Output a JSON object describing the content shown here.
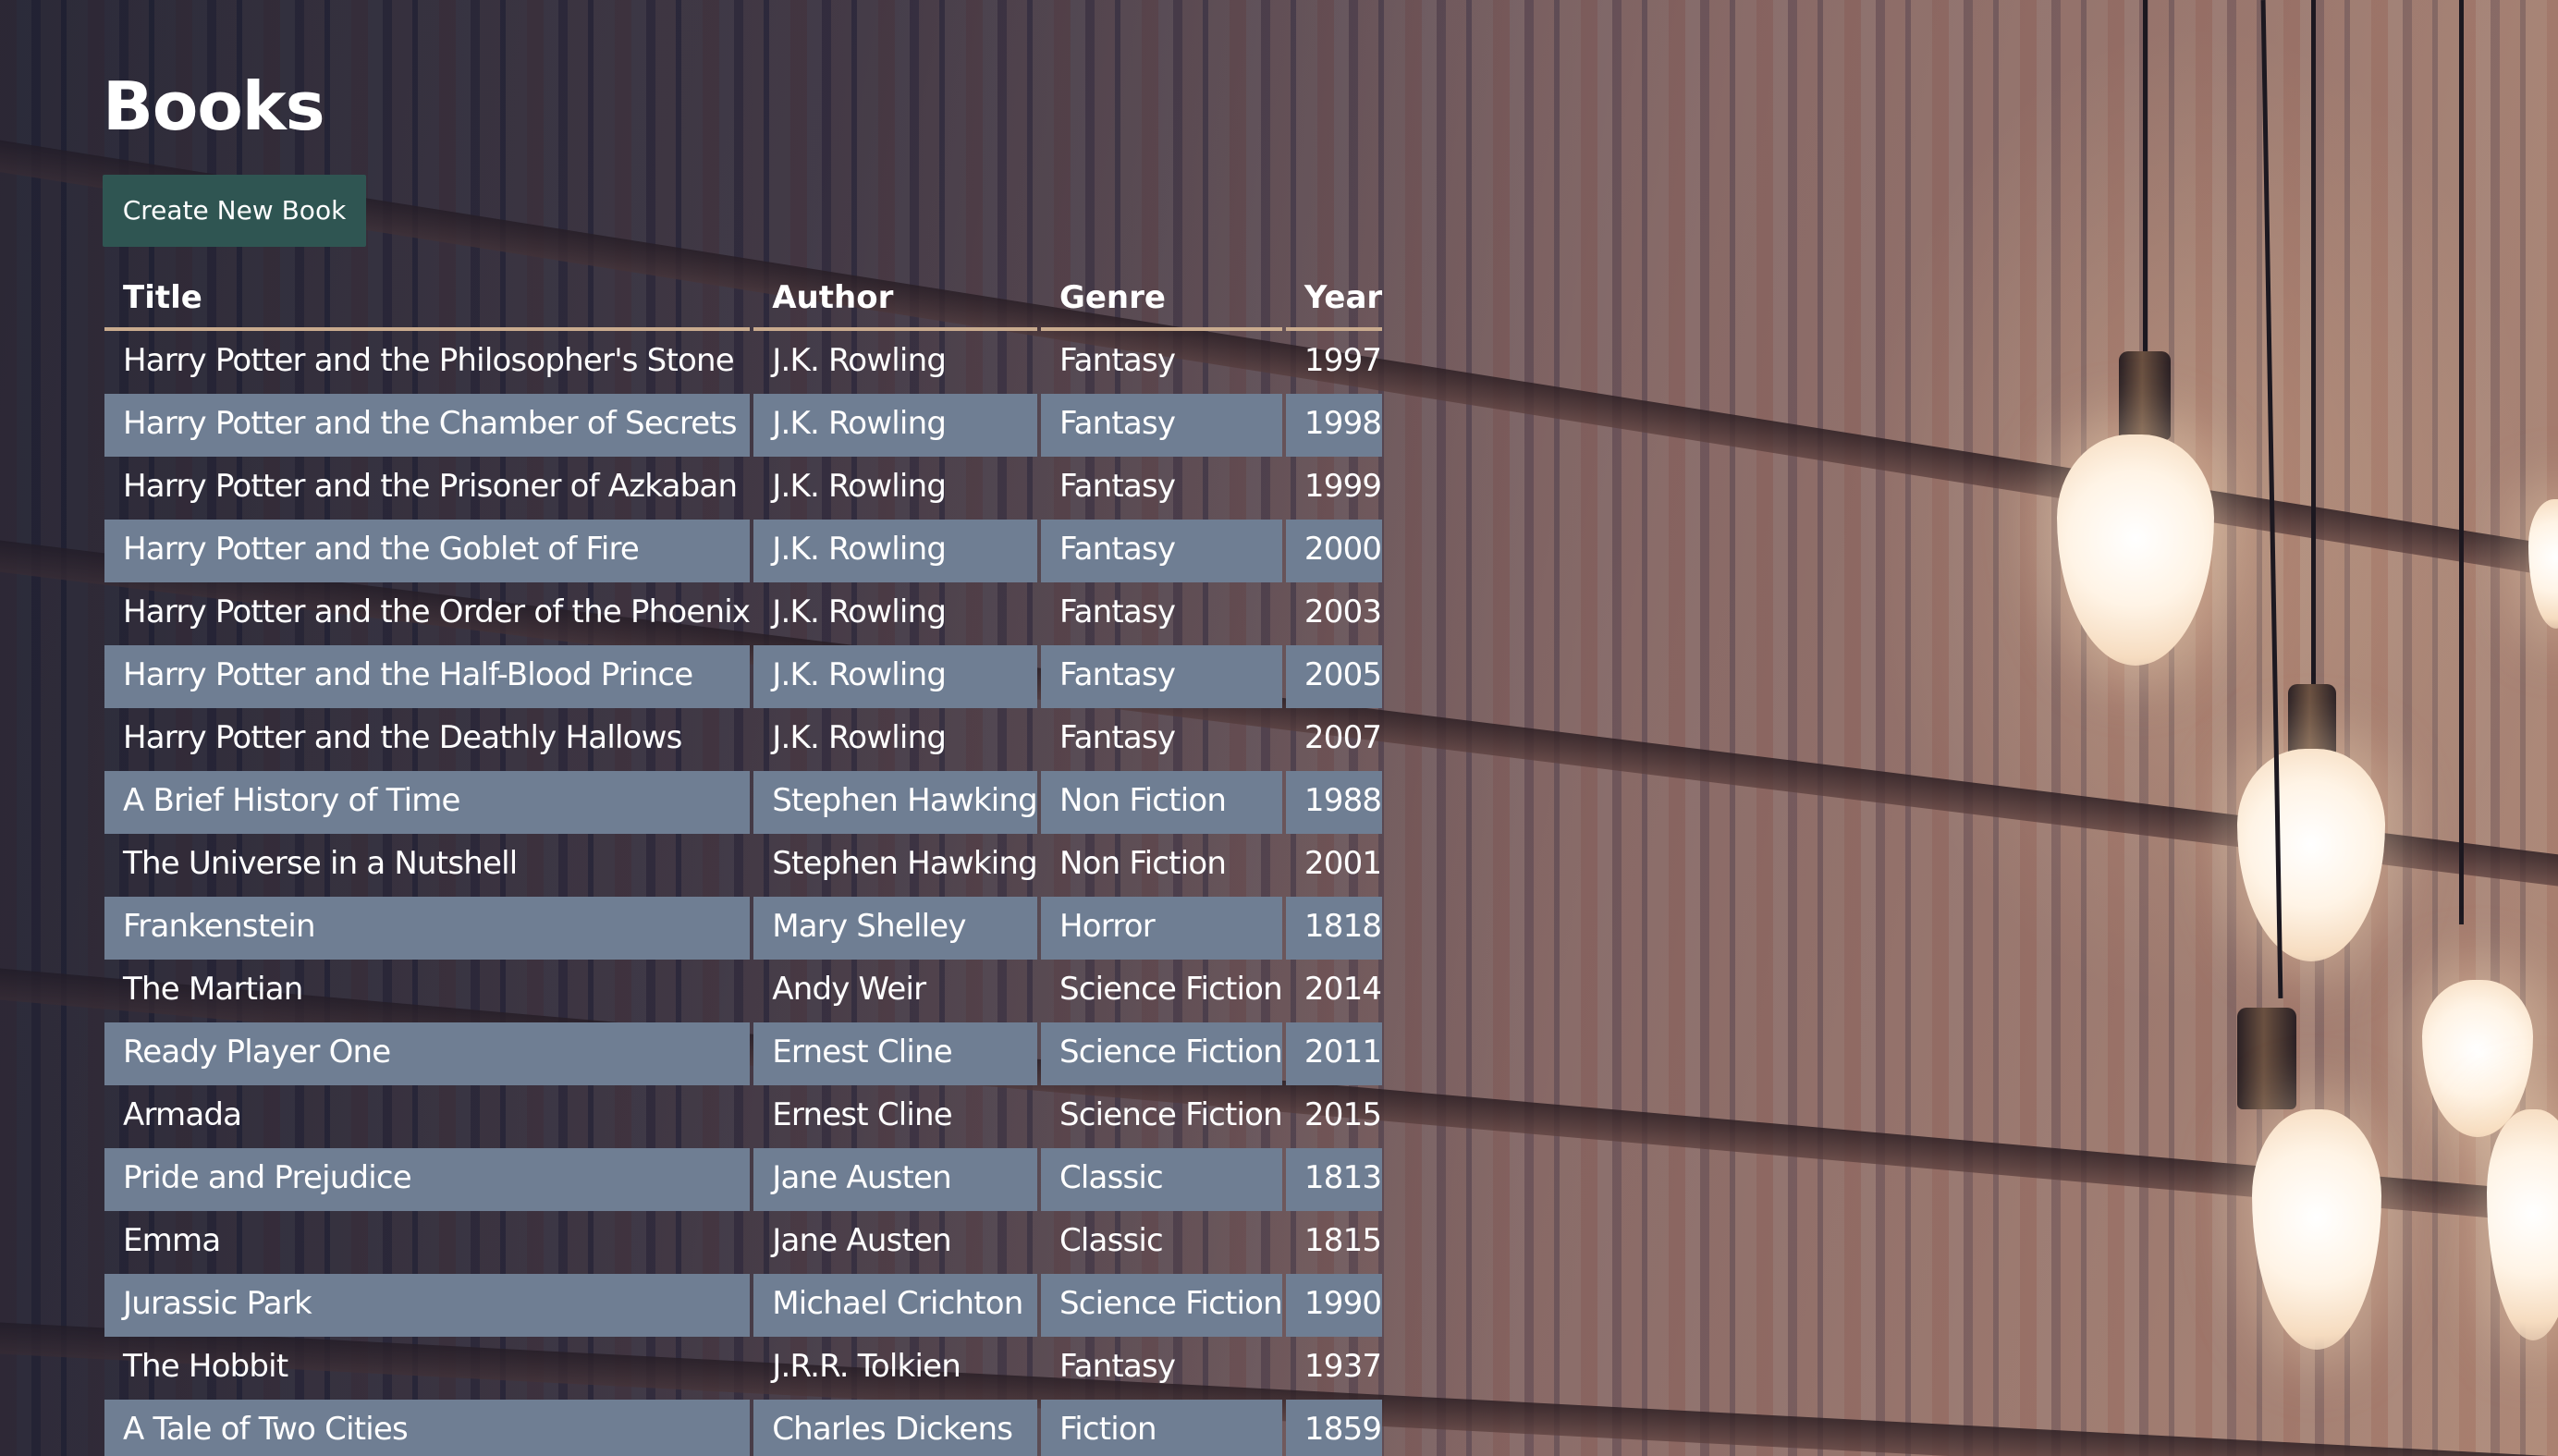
{
  "page": {
    "title": "Books",
    "create_button_label": "Create New Book"
  },
  "table": {
    "headers": {
      "title": "Title",
      "author": "Author",
      "genre": "Genre",
      "year": "Year"
    },
    "rows": [
      {
        "title": "Harry Potter and the Philosopher's Stone",
        "author": "J.K. Rowling",
        "genre": "Fantasy",
        "year": "1997"
      },
      {
        "title": "Harry Potter and the Chamber of Secrets",
        "author": "J.K. Rowling",
        "genre": "Fantasy",
        "year": "1998"
      },
      {
        "title": "Harry Potter and the Prisoner of Azkaban",
        "author": "J.K. Rowling",
        "genre": "Fantasy",
        "year": "1999"
      },
      {
        "title": "Harry Potter and the Goblet of Fire",
        "author": "J.K. Rowling",
        "genre": "Fantasy",
        "year": "2000"
      },
      {
        "title": "Harry Potter and the Order of the Phoenix",
        "author": "J.K. Rowling",
        "genre": "Fantasy",
        "year": "2003"
      },
      {
        "title": "Harry Potter and the Half-Blood Prince",
        "author": "J.K. Rowling",
        "genre": "Fantasy",
        "year": "2005"
      },
      {
        "title": "Harry Potter and the Deathly Hallows",
        "author": "J.K. Rowling",
        "genre": "Fantasy",
        "year": "2007"
      },
      {
        "title": "A Brief History of Time",
        "author": "Stephen Hawking",
        "genre": "Non Fiction",
        "year": "1988"
      },
      {
        "title": "The Universe in a Nutshell",
        "author": "Stephen Hawking",
        "genre": "Non Fiction",
        "year": "2001"
      },
      {
        "title": "Frankenstein",
        "author": "Mary Shelley",
        "genre": "Horror",
        "year": "1818"
      },
      {
        "title": "The Martian",
        "author": "Andy Weir",
        "genre": "Science Fiction",
        "year": "2014"
      },
      {
        "title": "Ready Player One",
        "author": "Ernest Cline",
        "genre": "Science Fiction",
        "year": "2011"
      },
      {
        "title": "Armada",
        "author": "Ernest Cline",
        "genre": "Science Fiction",
        "year": "2015"
      },
      {
        "title": "Pride and Prejudice",
        "author": "Jane Austen",
        "genre": "Classic",
        "year": "1813"
      },
      {
        "title": "Emma",
        "author": "Jane Austen",
        "genre": "Classic",
        "year": "1815"
      },
      {
        "title": "Jurassic Park",
        "author": "Michael Crichton",
        "genre": "Science Fiction",
        "year": "1990"
      },
      {
        "title": "The Hobbit",
        "author": "J.R.R. Tolkien",
        "genre": "Fantasy",
        "year": "1937"
      },
      {
        "title": "A Tale of Two Cities",
        "author": "Charles Dickens",
        "genre": "Fiction",
        "year": "1859"
      }
    ]
  },
  "colors": {
    "button_bg": "#2f5552",
    "stripe_row_bg": "#6f7e93",
    "header_rule": "#c9ab8e",
    "text": "#ffffff"
  }
}
